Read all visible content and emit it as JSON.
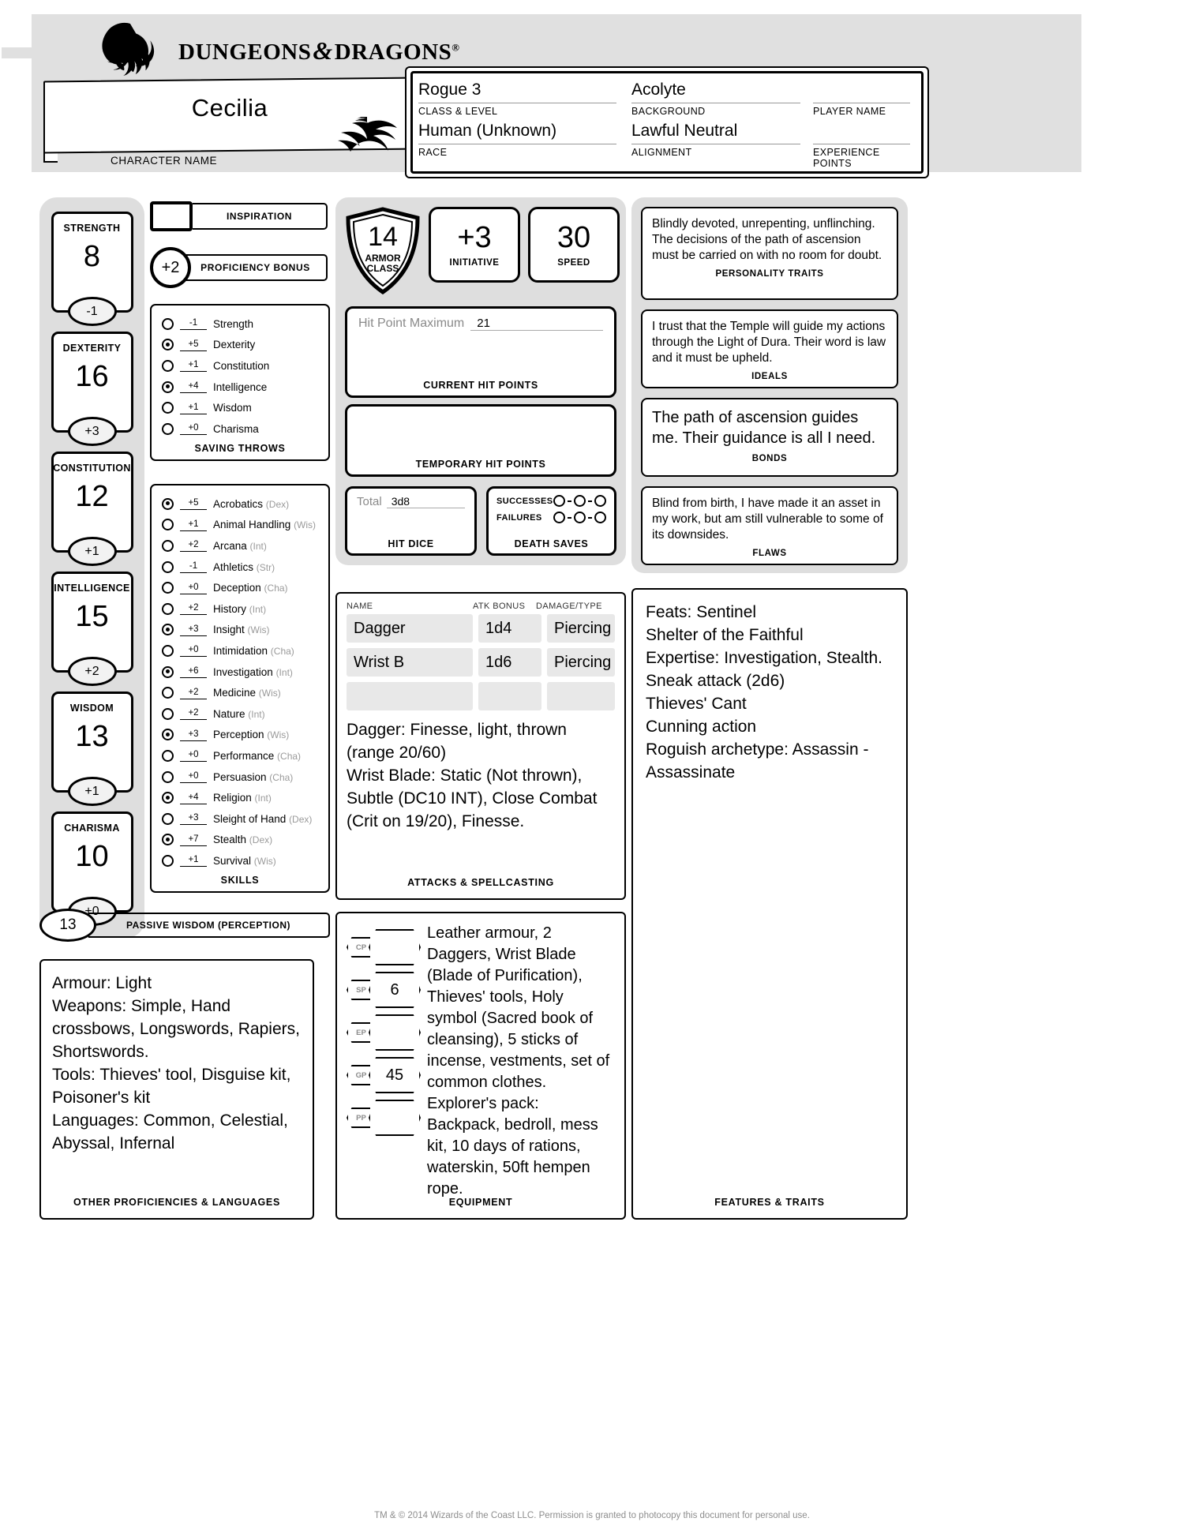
{
  "header": {
    "brand": "DUNGEONS",
    "brand2": "DRAGONS",
    "reg": "®",
    "amp": "&",
    "character_name": "Cecilia",
    "character_name_label": "CHARACTER NAME",
    "fields": [
      {
        "value": "Rogue 3",
        "label": "CLASS & LEVEL"
      },
      {
        "value": "Acolyte",
        "label": "BACKGROUND"
      },
      {
        "value": "",
        "label": "PLAYER NAME"
      },
      {
        "value": "Human (Unknown)",
        "label": "RACE"
      },
      {
        "value": "Lawful Neutral",
        "label": "ALIGNMENT"
      },
      {
        "value": "",
        "label": "EXPERIENCE POINTS"
      }
    ]
  },
  "abilities": [
    {
      "name": "STRENGTH",
      "score": "8",
      "mod": "-1"
    },
    {
      "name": "DEXTERITY",
      "score": "16",
      "mod": "+3"
    },
    {
      "name": "CONSTITUTION",
      "score": "12",
      "mod": "+1"
    },
    {
      "name": "INTELLIGENCE",
      "score": "15",
      "mod": "+2"
    },
    {
      "name": "WISDOM",
      "score": "13",
      "mod": "+1"
    },
    {
      "name": "CHARISMA",
      "score": "10",
      "mod": "+0"
    }
  ],
  "inspiration": {
    "label": "INSPIRATION",
    "value": ""
  },
  "proficiency_bonus": {
    "label": "PROFICIENCY BONUS",
    "value": "+2"
  },
  "saving_throws": {
    "label": "SAVING THROWS",
    "rows": [
      {
        "prof": false,
        "mod": "-1",
        "name": "Strength"
      },
      {
        "prof": true,
        "mod": "+5",
        "name": "Dexterity"
      },
      {
        "prof": false,
        "mod": "+1",
        "name": "Constitution"
      },
      {
        "prof": true,
        "mod": "+4",
        "name": "Intelligence"
      },
      {
        "prof": false,
        "mod": "+1",
        "name": "Wisdom"
      },
      {
        "prof": false,
        "mod": "+0",
        "name": "Charisma"
      }
    ]
  },
  "skills": {
    "label": "SKILLS",
    "rows": [
      {
        "prof": true,
        "mod": "+5",
        "name": "Acrobatics",
        "abil": "(Dex)"
      },
      {
        "prof": false,
        "mod": "+1",
        "name": "Animal Handling",
        "abil": "(Wis)"
      },
      {
        "prof": false,
        "mod": "+2",
        "name": "Arcana",
        "abil": "(Int)"
      },
      {
        "prof": false,
        "mod": "-1",
        "name": "Athletics",
        "abil": "(Str)"
      },
      {
        "prof": false,
        "mod": "+0",
        "name": "Deception",
        "abil": "(Cha)"
      },
      {
        "prof": false,
        "mod": "+2",
        "name": "History",
        "abil": "(Int)"
      },
      {
        "prof": true,
        "mod": "+3",
        "name": "Insight",
        "abil": "(Wis)"
      },
      {
        "prof": false,
        "mod": "+0",
        "name": "Intimidation",
        "abil": "(Cha)"
      },
      {
        "prof": true,
        "mod": "+6",
        "name": "Investigation",
        "abil": "(Int)"
      },
      {
        "prof": false,
        "mod": "+2",
        "name": "Medicine",
        "abil": "(Wis)"
      },
      {
        "prof": false,
        "mod": "+2",
        "name": "Nature",
        "abil": "(Int)"
      },
      {
        "prof": true,
        "mod": "+3",
        "name": "Perception",
        "abil": "(Wis)"
      },
      {
        "prof": false,
        "mod": "+0",
        "name": "Performance",
        "abil": "(Cha)"
      },
      {
        "prof": false,
        "mod": "+0",
        "name": "Persuasion",
        "abil": "(Cha)"
      },
      {
        "prof": true,
        "mod": "+4",
        "name": "Religion",
        "abil": "(Int)"
      },
      {
        "prof": false,
        "mod": "+3",
        "name": "Sleight of Hand",
        "abil": "(Dex)"
      },
      {
        "prof": true,
        "mod": "+7",
        "name": "Stealth",
        "abil": "(Dex)"
      },
      {
        "prof": false,
        "mod": "+1",
        "name": "Survival",
        "abil": "(Wis)"
      }
    ]
  },
  "passive": {
    "value": "13",
    "label": "PASSIVE WISDOM (PERCEPTION)"
  },
  "other_proficiencies": {
    "label": "OTHER PROFICIENCIES & LANGUAGES",
    "text": "Armour: Light\nWeapons: Simple, Hand crossbows, Longswords, Rapiers, Shortswords.\nTools: Thieves' tool, Disguise kit, Poisoner's kit\nLanguages: Common, Celestial, Abyssal, Infernal"
  },
  "combat": {
    "armor_class": {
      "value": "14",
      "label_line1": "ARMOR",
      "label_line2": "CLASS"
    },
    "initiative": {
      "value": "+3",
      "label": "INITIATIVE"
    },
    "speed": {
      "value": "30",
      "label": "SPEED"
    },
    "hit_point_maximum_label": "Hit Point Maximum",
    "hit_point_maximum": "21",
    "current_hp_label": "CURRENT HIT POINTS",
    "current_hp": "",
    "temp_hp_label": "TEMPORARY HIT POINTS",
    "temp_hp": "",
    "hit_dice": {
      "total_label": "Total",
      "total": "3d8",
      "label": "HIT DICE"
    },
    "death_saves": {
      "label": "DEATH SAVES",
      "successes_label": "SUCCESSES",
      "failures_label": "FAILURES",
      "successes": 0,
      "failures": 0
    }
  },
  "attacks": {
    "label": "ATTACKS & SPELLCASTING",
    "headers": [
      "NAME",
      "ATK BONUS",
      "DAMAGE/TYPE"
    ],
    "rows": [
      {
        "name": "Dagger",
        "atk": "1d4",
        "dmg": "Piercing"
      },
      {
        "name": "Wrist B",
        "atk": "1d6",
        "dmg": "Piercing"
      },
      {
        "name": "",
        "atk": "",
        "dmg": ""
      }
    ],
    "notes": "Dagger: Finesse, light, thrown (range 20/60)\nWrist Blade: Static (Not thrown), Subtle (DC10 INT), Close Combat (Crit on 19/20), Finesse."
  },
  "equipment": {
    "label": "EQUIPMENT",
    "coins": [
      {
        "code": "CP",
        "value": ""
      },
      {
        "code": "SP",
        "value": "6"
      },
      {
        "code": "EP",
        "value": ""
      },
      {
        "code": "GP",
        "value": "45"
      },
      {
        "code": "PP",
        "value": ""
      }
    ],
    "text": "Leather armour, 2 Daggers, Wrist Blade (Blade of Purification), Thieves' tools, Holy symbol (Sacred book of cleansing), 5 sticks of incense, vestments, set of common clothes.\nExplorer's pack: Backpack, bedroll, mess kit, 10 days of rations, waterskin, 50ft hempen rope."
  },
  "personality": {
    "traits": {
      "label": "PERSONALITY TRAITS",
      "text": "Blindly devoted, unrepenting, unflinching. The decisions of the path of ascension must be carried on with no room for doubt."
    },
    "ideals": {
      "label": "IDEALS",
      "text": "I trust that the Temple will guide my actions through the Light of Dura. Their word is law and it must be upheld."
    },
    "bonds": {
      "label": "BONDS",
      "text": "The path of ascension guides me. Their guidance is all I need."
    },
    "flaws": {
      "label": "FLAWS",
      "text": "Blind from birth, I have made it an asset in my work, but am still vulnerable to some of its downsides."
    }
  },
  "features": {
    "label": "FEATURES & TRAITS",
    "text": "Feats: Sentinel\nShelter of the Faithful\nExpertise: Investigation, Stealth.\nSneak attack (2d6)\nThieves' Cant\nCunning action\nRoguish archetype: Assassin - Assassinate"
  },
  "footer": "TM & © 2014 Wizards of the Coast LLC. Permission is granted to photocopy this document for personal use."
}
